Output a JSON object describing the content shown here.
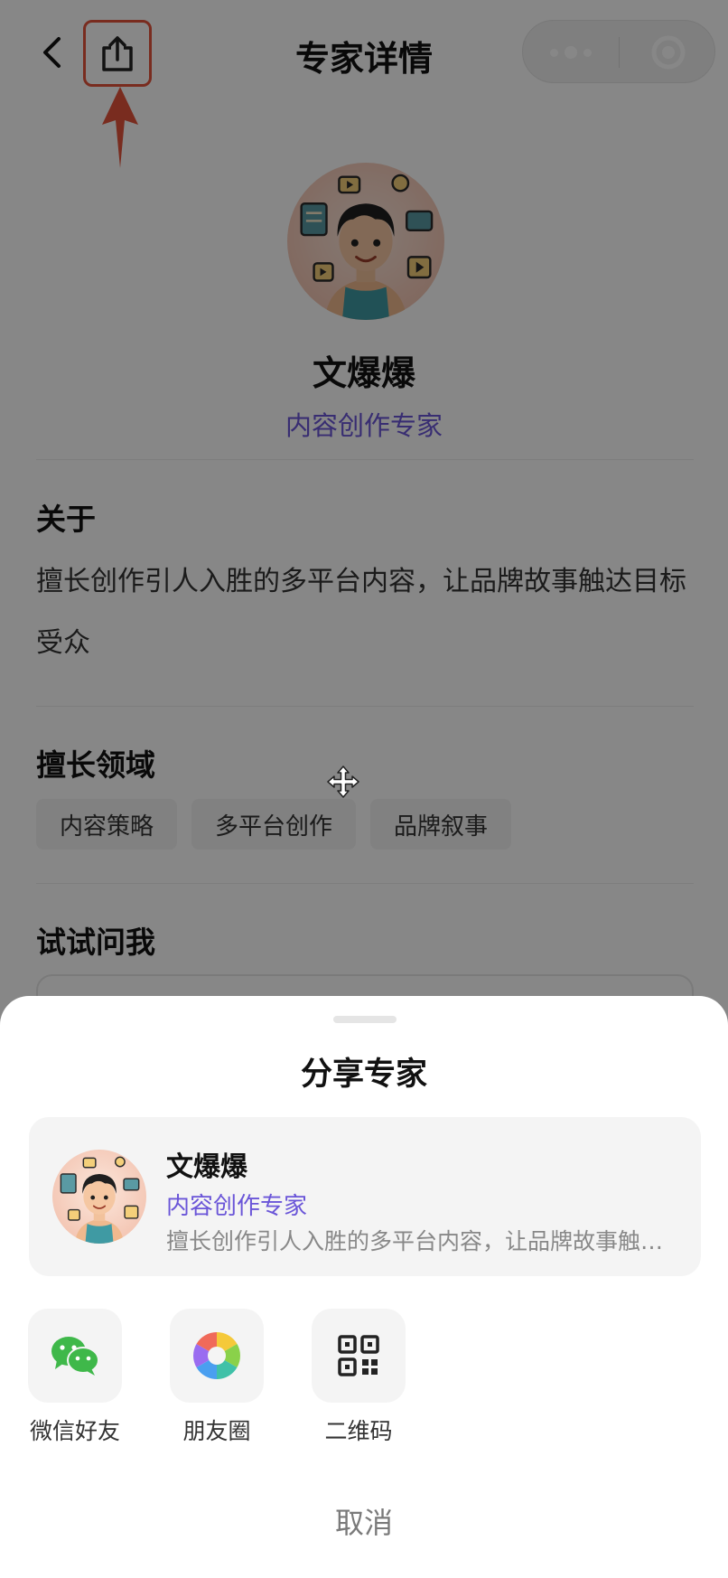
{
  "header": {
    "title": "专家详情",
    "back_icon": "chevron-left-icon",
    "share_icon": "share-upload-icon",
    "more_icon": "more-dots-icon",
    "close_icon": "target-circle-icon"
  },
  "profile": {
    "name": "文爆爆",
    "role": "内容创作专家"
  },
  "about": {
    "title": "关于",
    "text": "擅长创作引人入胜的多平台内容，让品牌故事触达目标受众"
  },
  "expertise": {
    "title": "擅长领域",
    "tags": [
      "内容策略",
      "多平台创作",
      "品牌叙事"
    ]
  },
  "ask": {
    "title": "试试问我"
  },
  "share_sheet": {
    "title": "分享专家",
    "card": {
      "name": "文爆爆",
      "role": "内容创作专家",
      "desc": "擅长创作引人入胜的多平台内容，让品牌故事触达目标受众"
    },
    "options": [
      {
        "label": "微信好友",
        "icon": "wechat-icon"
      },
      {
        "label": "朋友圈",
        "icon": "moments-icon"
      },
      {
        "label": "二维码",
        "icon": "qr-code-icon"
      }
    ],
    "cancel": "取消"
  },
  "colors": {
    "accent": "#6a55d8",
    "annotation": "#e4533c",
    "overlay": "rgba(0,0,0,0.47)"
  }
}
